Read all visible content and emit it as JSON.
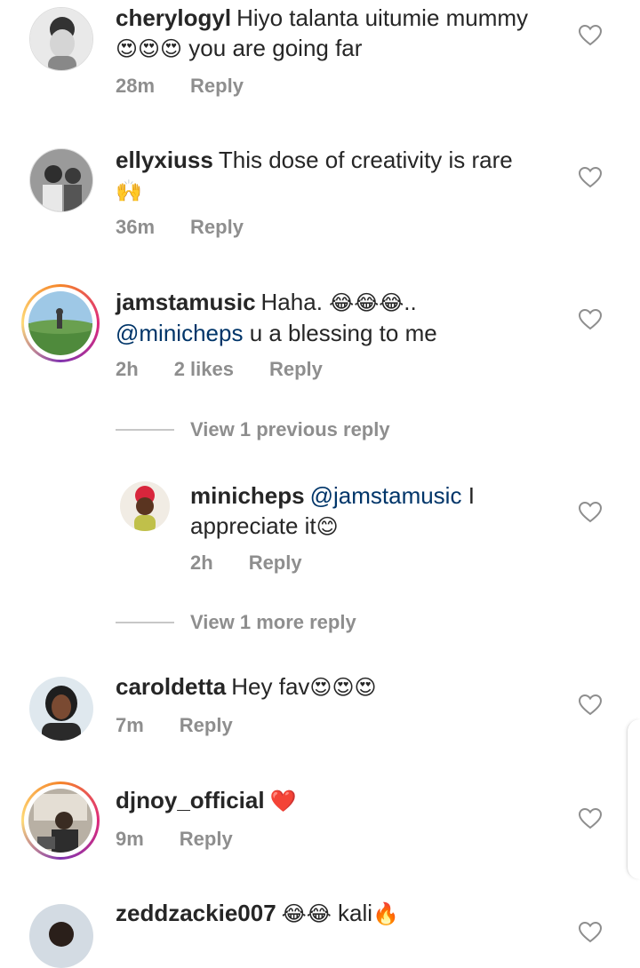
{
  "comments": [
    {
      "username": "cherylogyl",
      "text": "Hiyo talanta uitumie mummy",
      "emoji": "😍😍😍",
      "text2": "you are going far",
      "time": "28m",
      "reply": "Reply"
    },
    {
      "username": "ellyxiuss",
      "text": "This dose of creativity is rare",
      "emoji": "🙌",
      "time": "36m",
      "reply": "Reply"
    },
    {
      "username": "jamstamusic",
      "text": "Haha.",
      "emoji": "😂😂😂",
      "text_after": "..",
      "mention": "@minicheps",
      "text2": "u a blessing to me",
      "time": "2h",
      "likes": "2 likes",
      "reply": "Reply"
    },
    {
      "username": "carolde tta",
      "text": "Hey fav",
      "emoji": "😍😍😍",
      "time": "7m",
      "reply": "Reply"
    },
    {
      "username": "djnoy_official",
      "emoji": "❤️",
      "time": "9m",
      "reply": "Reply"
    },
    {
      "username": "zeddzackie007",
      "emoji": "😂😂",
      "text": "kali",
      "emoji2": "🔥"
    }
  ],
  "view_previous": "View 1 previous reply",
  "view_more": "View 1 more reply",
  "reply": {
    "username": "minicheps",
    "mention": "@jamstamusic",
    "text": "I",
    "text2": "appreciate it",
    "emoji": "😊",
    "time": "2h",
    "reply": "Reply"
  },
  "colors": {
    "text": "#262626",
    "meta": "#8e8e8e",
    "mention": "#003569",
    "heart_red": "#e0245e"
  }
}
